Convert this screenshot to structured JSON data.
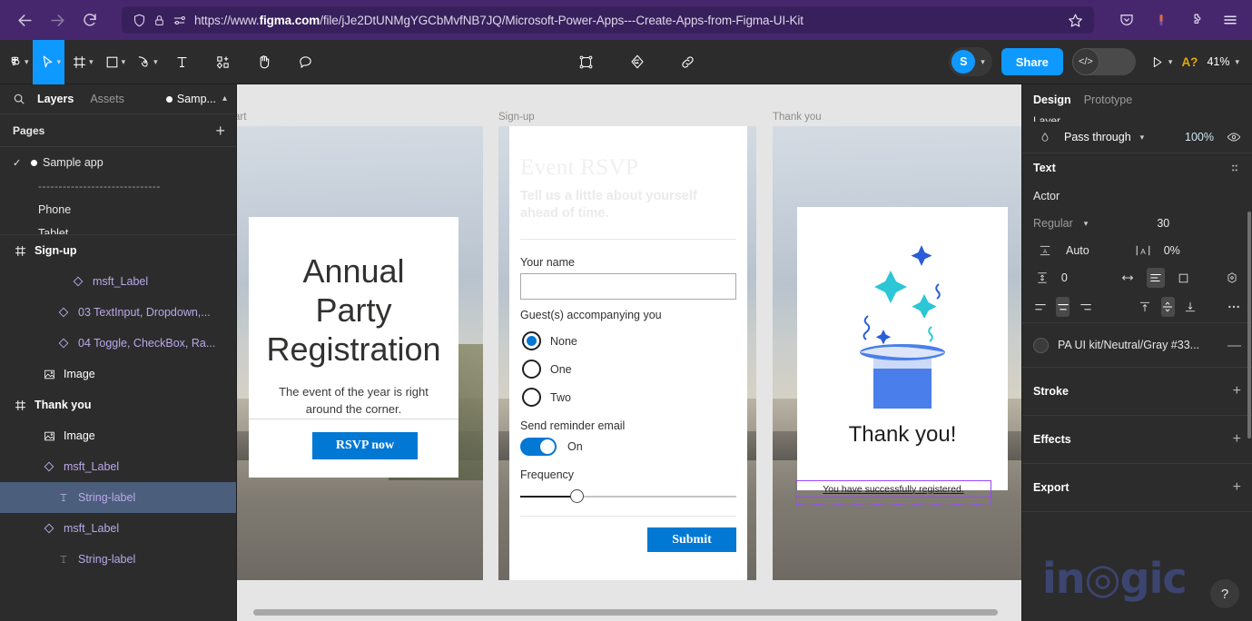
{
  "browser": {
    "back_icon": "back-arrow-icon",
    "forward_icon": "forward-arrow-icon",
    "reload_icon": "reload-icon",
    "shield_icon": "shield-icon",
    "lock_icon": "lock-icon",
    "permissions_icon": "permissions-icon",
    "url_prefix": "https://www.",
    "url_domain": "figma.com",
    "url_path": "/file/jJe2DtUNMgYGCbMvfNB7JQ/Microsoft-Power-Apps---Create-Apps-from-Figma-UI-Kit",
    "bookmark_icon": "star-icon",
    "pocket_icon": "pocket-icon",
    "account_icon": "account-icon",
    "extensions_icon": "extensions-icon",
    "menu_icon": "hamburger-menu-icon"
  },
  "toolbar": {
    "menu_label": "figma-logo-icon",
    "move_label": "move-tool-icon",
    "frame_label": "frame-tool-icon",
    "shape_label": "rectangle-tool-icon",
    "pen_label": "pen-tool-icon",
    "text_label": "text-tool-icon",
    "component_label": "component-tool-icon",
    "hand_label": "hand-tool-icon",
    "comment_label": "comment-tool-icon",
    "center_scale": "scale-tool-icon",
    "center_plugin": "plugins-icon",
    "center_link": "link-icon",
    "avatar_initial": "S",
    "share_label": "Share",
    "devmode_label": "</>",
    "present_label": "present-icon",
    "help_label": "A?",
    "zoom_label": "41%"
  },
  "left_panel": {
    "search_icon": "search-icon",
    "tabs": [
      {
        "label": "Layers",
        "active": true
      },
      {
        "label": "Assets",
        "active": false
      }
    ],
    "file_name": "Samp...",
    "pages_header": "Pages",
    "pages_add": "+",
    "pages": [
      {
        "label": "Sample app",
        "checked": true,
        "type": "page"
      },
      {
        "label": "------------------------------",
        "checked": false,
        "type": "divider"
      },
      {
        "label": "Phone",
        "checked": false,
        "type": "page"
      },
      {
        "label": "Tablet",
        "checked": false,
        "type": "page"
      }
    ],
    "layers": [
      {
        "label": "Sign-up",
        "icon": "frame-icon",
        "kind": "frame",
        "indent": 0,
        "selected": false
      },
      {
        "label": "msft_Label",
        "icon": "component-icon",
        "kind": "comp",
        "indent": 3,
        "selected": false
      },
      {
        "label": "03 TextInput, Dropdown,...",
        "icon": "component-icon",
        "kind": "comp",
        "indent": 2,
        "selected": false
      },
      {
        "label": "04 Toggle, CheckBox, Ra...",
        "icon": "component-icon",
        "kind": "comp",
        "indent": 2,
        "selected": false
      },
      {
        "label": "Image",
        "icon": "image-icon",
        "kind": "img",
        "indent": 1,
        "selected": false
      },
      {
        "label": "Thank you",
        "icon": "frame-icon",
        "kind": "frame",
        "indent": 0,
        "selected": false
      },
      {
        "label": "Image",
        "icon": "image-icon",
        "kind": "img",
        "indent": 1,
        "selected": false
      },
      {
        "label": "msft_Label",
        "icon": "component-icon",
        "kind": "comp",
        "indent": 1,
        "selected": false
      },
      {
        "label": "String-label",
        "icon": "text-icon",
        "kind": "txt",
        "indent": 2,
        "selected": true
      },
      {
        "label": "msft_Label",
        "icon": "component-icon",
        "kind": "comp",
        "indent": 1,
        "selected": false
      },
      {
        "label": "String-label",
        "icon": "text-icon",
        "kind": "txt",
        "indent": 2,
        "selected": false
      }
    ]
  },
  "canvas": {
    "frames": [
      {
        "label": "art"
      },
      {
        "label": "Sign-up"
      },
      {
        "label": "Thank you"
      }
    ],
    "frame1": {
      "title": "Annual Party Registration",
      "subtitle": "The event of the year is right around the corner.",
      "button": "RSVP now"
    },
    "frame2": {
      "heading": "Event RSVP",
      "subheading": "Tell us a little about yourself ahead of time.",
      "name_label": "Your name",
      "name_value": "",
      "guests_label": "Guest(s) accompanying you",
      "radios": [
        {
          "label": "None",
          "selected": true
        },
        {
          "label": "One",
          "selected": false
        },
        {
          "label": "Two",
          "selected": false
        }
      ],
      "toggle_label": "Send reminder email",
      "toggle_state": "On",
      "frequency_label": "Frequency",
      "frequency_value": 25,
      "submit": "Submit"
    },
    "frame3": {
      "title": "Thank you!",
      "selected_text": "You have successfully registered."
    }
  },
  "right_panel": {
    "tabs": [
      {
        "label": "Design",
        "active": true
      },
      {
        "label": "Prototype",
        "active": false
      }
    ],
    "layer_section_label": "Layer",
    "blend_mode": "Pass through",
    "opacity": "100%",
    "visibility_icon": "eye-icon",
    "text_section": "Text",
    "text_settings_icon": "text-settings-icon",
    "font_family": "Actor",
    "font_style": "Regular",
    "font_size": "30",
    "line_height_icon": "line-height-icon",
    "line_height": "Auto",
    "letter_spacing_icon": "letter-spacing-icon",
    "letter_spacing": "0%",
    "paragraph_icon": "paragraph-spacing-icon",
    "paragraph_spacing": "0",
    "resize_icon": "horizontal-resize-icon",
    "align_left_icon": "align-left-icon",
    "truncate_icon": "truncate-icon",
    "type_detail_icon": "type-detail-icon",
    "h_align": [
      "align-text-left-icon",
      "align-text-center-icon",
      "align-text-right-icon"
    ],
    "v_align": [
      "align-top-icon",
      "align-middle-icon",
      "align-bottom-icon"
    ],
    "more_icon": "more-options-icon",
    "fill_swatch_name": "PA UI kit/Neutral/Gray #33...",
    "fill_remove": "—",
    "sections": [
      {
        "label": "Stroke",
        "add": "+"
      },
      {
        "label": "Effects",
        "add": "+"
      },
      {
        "label": "Export",
        "add": "+"
      }
    ],
    "watermark": "in◎gic",
    "help_label": "?"
  },
  "colors": {
    "browser_chrome": "#46276e",
    "figma_bg": "#2c2c2c",
    "accent_blue": "#0d99ff",
    "ms_blue": "#0078d4",
    "selection_purple": "#9747ff",
    "layer_selected": "#4b5e7c",
    "component_purple": "#b9a9e8"
  }
}
